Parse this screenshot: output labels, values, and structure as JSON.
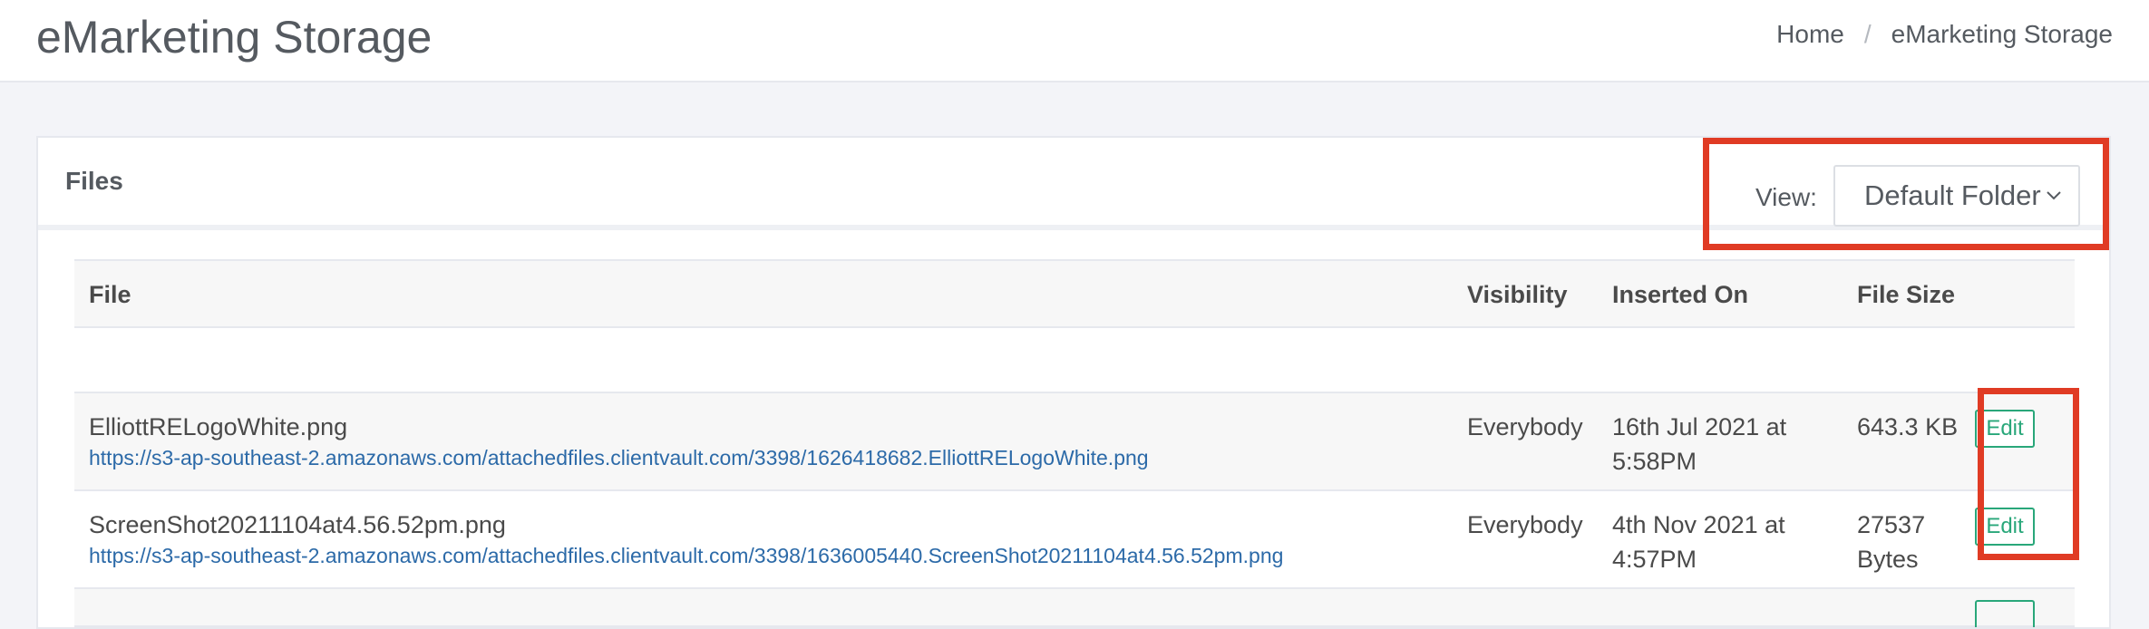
{
  "header": {
    "title": "eMarketing Storage",
    "breadcrumb": [
      {
        "label": "Home"
      },
      {
        "separator": "/"
      },
      {
        "label": "eMarketing Storage"
      }
    ]
  },
  "card": {
    "title": "Files",
    "view_label": "View:",
    "view_select": {
      "selected": "Default Folder"
    }
  },
  "table": {
    "columns": [
      "File",
      "Visibility",
      "Inserted On",
      "File Size"
    ],
    "rows": [
      {
        "name": "ElliottRELogoWhite.png",
        "url": "https://s3-ap-southeast-2.amazonaws.com/attachedfiles.clientvault.com/3398/1626418682.ElliottRELogoWhite.png",
        "visibility": "Everybody",
        "inserted_on": "16th Jul 2021 at 5:58PM",
        "size": "643.3 KB",
        "action": "Edit"
      },
      {
        "name": "ScreenShot20211104at4.56.52pm.png",
        "url": "https://s3-ap-southeast-2.amazonaws.com/attachedfiles.clientvault.com/3398/1636005440.ScreenShot20211104at4.56.52pm.png",
        "visibility": "Everybody",
        "inserted_on": "4th Nov 2021 at 4:57PM",
        "size": "27537 Bytes",
        "action": "Edit"
      }
    ]
  },
  "colors": {
    "highlight": "#e03b24",
    "edit_button": "#29a77a",
    "link": "#2c6aa8"
  },
  "icons": {
    "select_arrow": "chevron-down-icon"
  }
}
